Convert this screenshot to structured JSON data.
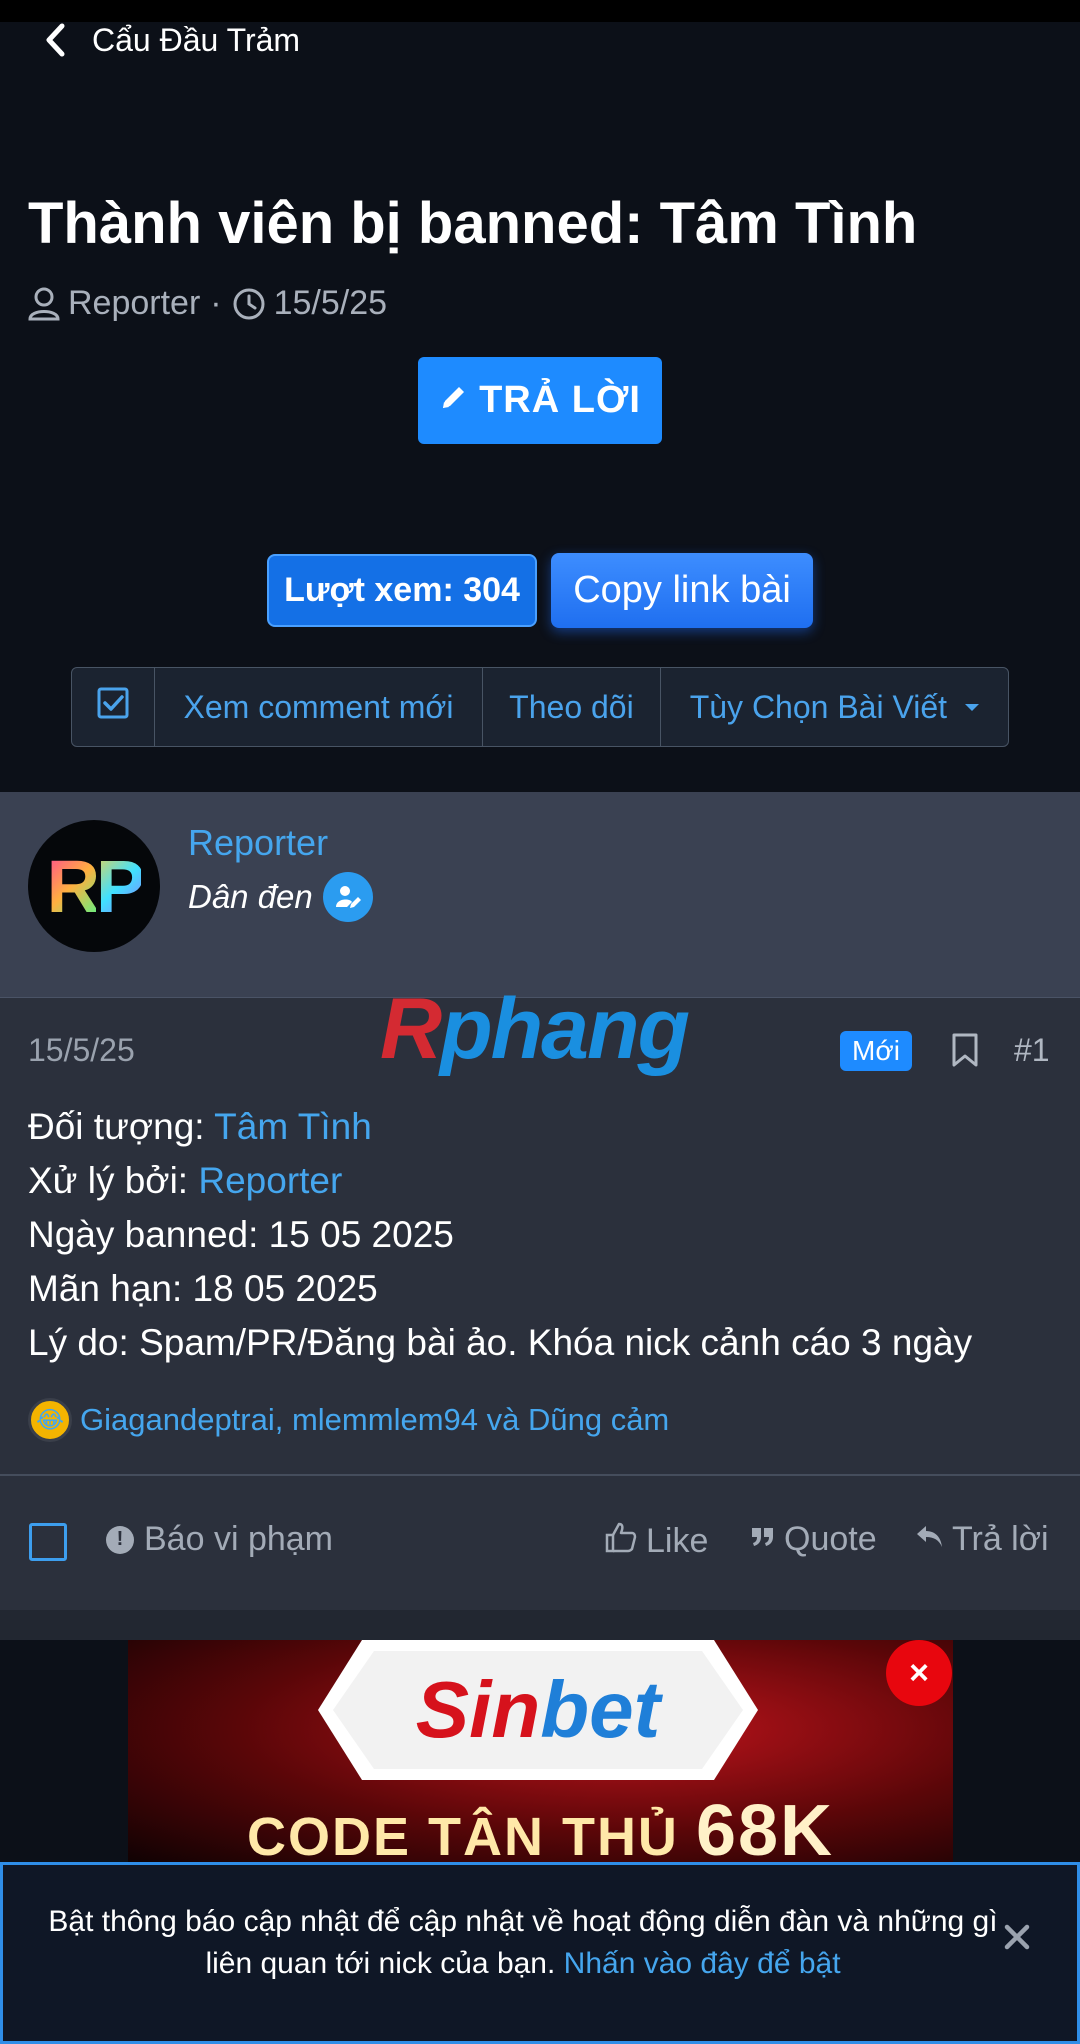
{
  "nav": {
    "back_label": "Cẩu Đầu Trảm"
  },
  "thread": {
    "title": "Thành viên bị banned: Tâm Tình",
    "author": "Reporter",
    "date": "15/5/25"
  },
  "buttons": {
    "reply": "TRẢ LỜI",
    "views": "Lượt xem: 304",
    "copy_link": "Copy link bài"
  },
  "toolbar": {
    "new_comments": "Xem comment mới",
    "follow": "Theo dõi",
    "options": "Tùy Chọn Bài Viết"
  },
  "post": {
    "avatar_initials_1": "R",
    "avatar_initials_2": "P",
    "author_name": "Reporter",
    "author_role": "Dân đen",
    "date": "15/5/25",
    "new_badge": "Mới",
    "number": "#1",
    "watermark_a": "R",
    "watermark_b": "phang",
    "lines": {
      "target_label": "Đối tượng: ",
      "target_value": "Tâm Tình",
      "handler_label": "Xử lý bởi: ",
      "handler_value": "Reporter",
      "banned_date": "Ngày banned: 15 05 2025",
      "expiry": "Mãn hạn: 18 05 2025",
      "reason": "Lý do: Spam/PR/Đăng bài ảo. Khóa nick cảnh cáo 3 ngày"
    },
    "reactions_text": "Giagandeptrai, mlemmlem94 và Dũng cảm",
    "actions": {
      "report": "Báo vi phạm",
      "like": "Like",
      "quote": "Quote",
      "reply": "Trả lời"
    }
  },
  "ad": {
    "brand_a": "Sin",
    "brand_b": "bet",
    "tagline_a": "CODE TÂN THỦ ",
    "tagline_b": "68K",
    "close": "×"
  },
  "notification": {
    "text": "Bật thông báo cập nhật để cập nhật về hoạt động diễn đàn và những gì liên quan tới nick của bạn. ",
    "link": "Nhấn vào đây để bật"
  },
  "colors": {
    "accent": "#1e8bff",
    "link": "#45a6ee",
    "background": "#0c1018",
    "post_header": "#3a4152",
    "post_body": "#2b303c"
  }
}
